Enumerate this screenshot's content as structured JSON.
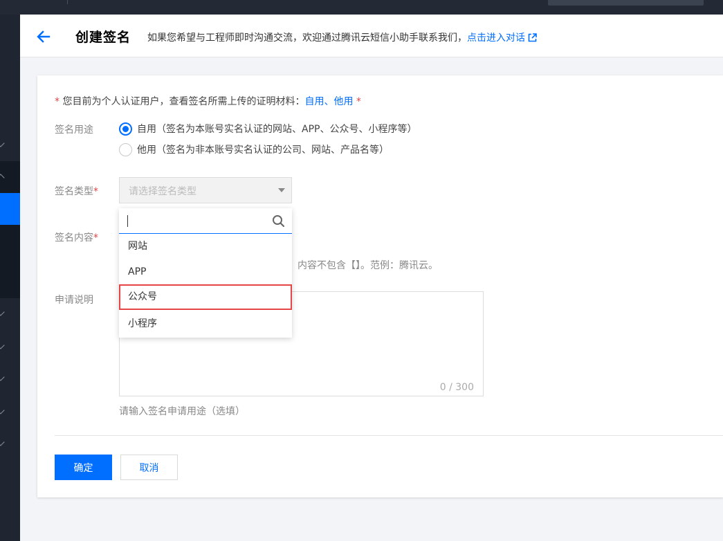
{
  "header": {
    "title": "创建签名",
    "description": "如果您希望与工程师即时沟通交流，欢迎通过腾讯云短信小助手联系我们，",
    "link_text": "点击进入对话"
  },
  "form": {
    "notice": {
      "asterisk": "*",
      "text": " 您目前为个人认证用户，查看签名所需上传的证明材料：",
      "link_self": "自用",
      "separator": "、",
      "link_other": "他用",
      "asterisk_end": " *"
    },
    "purpose": {
      "label": "签名用途",
      "options": [
        {
          "text": "自用（签名为本账号实名认证的网站、APP、公众号、小程序等）",
          "checked": true
        },
        {
          "text": "他用（签名为非本账号实名认证的公司、网站、产品名等）",
          "checked": false
        }
      ]
    },
    "type": {
      "label": "签名类型",
      "required_mark": "*",
      "placeholder": "请选择签名类型"
    },
    "content": {
      "label": "签名内容",
      "required_mark": "*",
      "hint": "内容不包含【】。范例：腾讯云。"
    },
    "description": {
      "label": "申请说明",
      "counter": "0 / 300",
      "help": "请输入签名申请用途（选填）"
    },
    "buttons": {
      "confirm": "确定",
      "cancel": "取消"
    }
  },
  "dropdown": {
    "search_value": "",
    "items": [
      "网站",
      "APP",
      "公众号",
      "小程序"
    ],
    "highlighted_index": 2
  },
  "colors": {
    "accent": "#006eff",
    "required": "#e54545",
    "sidebar": "#1f2631",
    "topbar": "#232a36"
  }
}
